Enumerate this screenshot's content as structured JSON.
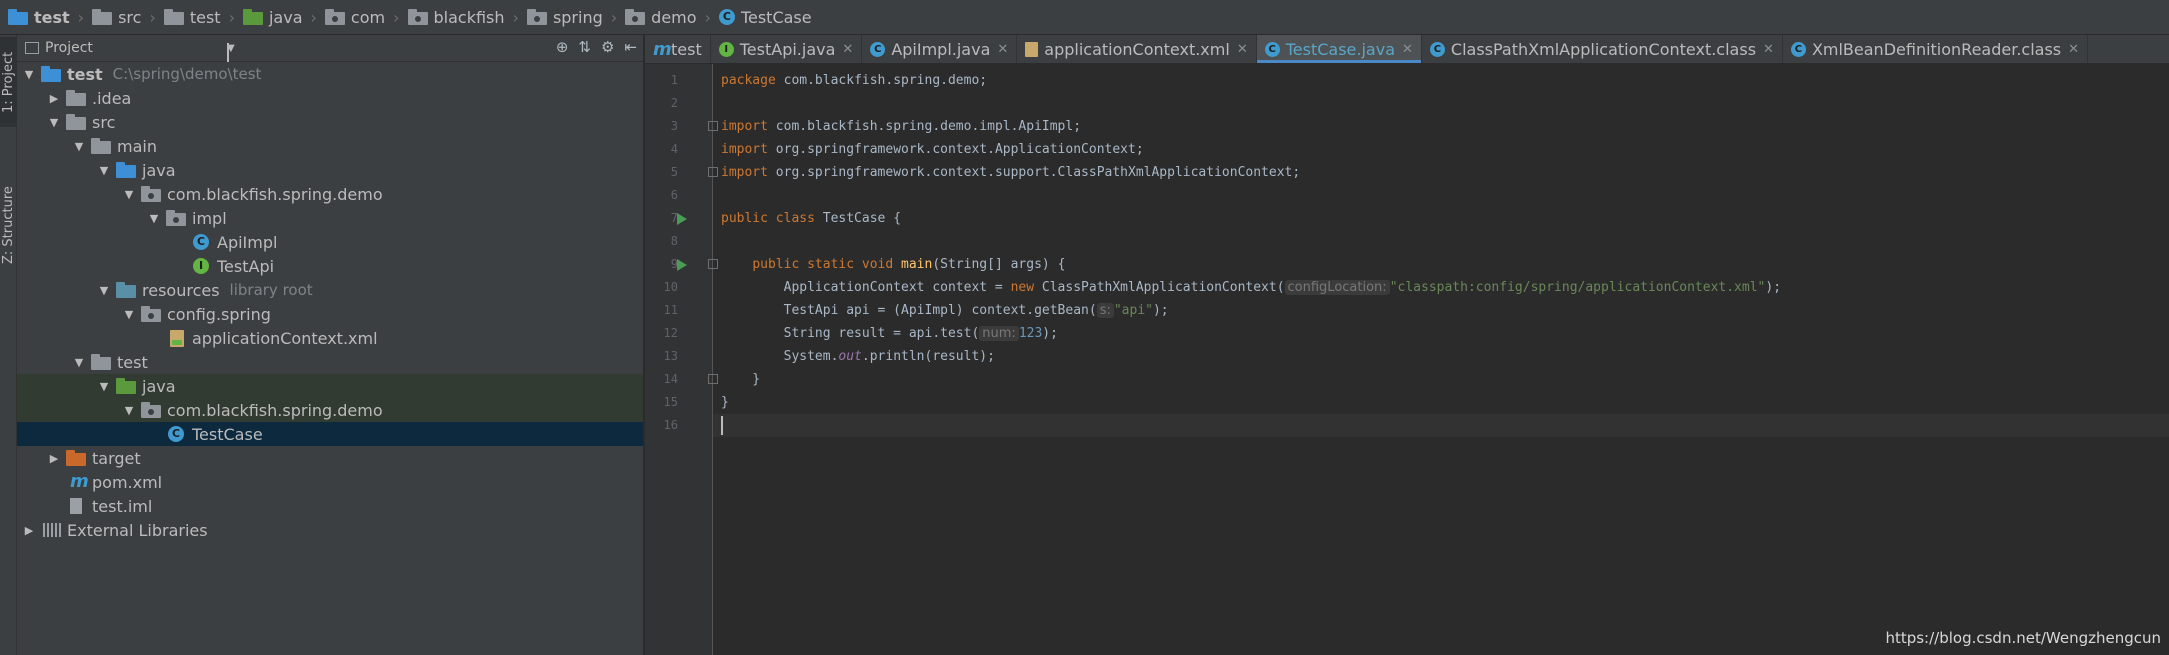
{
  "breadcrumb": [
    {
      "label": "test",
      "icon": "project-folder-icon",
      "bold": true
    },
    {
      "label": "src",
      "icon": "folder-icon"
    },
    {
      "label": "test",
      "icon": "folder-icon"
    },
    {
      "label": "java",
      "icon": "source-folder-icon"
    },
    {
      "label": "com",
      "icon": "package-icon"
    },
    {
      "label": "blackfish",
      "icon": "package-icon"
    },
    {
      "label": "spring",
      "icon": "package-icon"
    },
    {
      "label": "demo",
      "icon": "package-icon"
    },
    {
      "label": "TestCase",
      "icon": "class-icon"
    }
  ],
  "tool_stripe": {
    "project": "1: Project",
    "structure": "Z: Structure"
  },
  "project_panel": {
    "title": "Project",
    "tree": [
      {
        "label": "test",
        "extra": "C:\\spring\\demo\\test",
        "arrow": "open",
        "icon": "module-folder",
        "bold": true
      },
      {
        "label": ".idea",
        "arrow": "closed",
        "icon": "folder"
      },
      {
        "label": "src",
        "arrow": "open",
        "icon": "folder"
      },
      {
        "label": "main",
        "arrow": "open",
        "icon": "folder"
      },
      {
        "label": "java",
        "arrow": "open",
        "icon": "source-folder"
      },
      {
        "label": "com.blackfish.spring.demo",
        "arrow": "open",
        "icon": "package"
      },
      {
        "label": "impl",
        "arrow": "open",
        "icon": "package"
      },
      {
        "label": "ApiImpl",
        "arrow": "",
        "icon": "class"
      },
      {
        "label": "TestApi",
        "arrow": "",
        "icon": "interface"
      },
      {
        "label": "resources",
        "extra": "library root",
        "arrow": "open",
        "icon": "resources-folder"
      },
      {
        "label": "config.spring",
        "arrow": "open",
        "icon": "package"
      },
      {
        "label": "applicationContext.xml",
        "arrow": "",
        "icon": "xml"
      },
      {
        "label": "test",
        "arrow": "open",
        "icon": "folder"
      },
      {
        "label": "java",
        "arrow": "open",
        "icon": "test-source-folder"
      },
      {
        "label": "com.blackfish.spring.demo",
        "arrow": "open",
        "icon": "package"
      },
      {
        "label": "TestCase",
        "arrow": "",
        "icon": "class"
      },
      {
        "label": "target",
        "arrow": "closed",
        "icon": "excluded-folder"
      },
      {
        "label": "pom.xml",
        "arrow": "",
        "icon": "maven"
      },
      {
        "label": "test.iml",
        "arrow": "",
        "icon": "file"
      },
      {
        "label": "External Libraries",
        "arrow": "closed",
        "icon": "libraries"
      }
    ]
  },
  "tabs": [
    {
      "label": "test",
      "icon": "maven"
    },
    {
      "label": "TestApi.java",
      "icon": "interface"
    },
    {
      "label": "ApiImpl.java",
      "icon": "class"
    },
    {
      "label": "applicationContext.xml",
      "icon": "xml"
    },
    {
      "label": "TestCase.java",
      "icon": "class",
      "active": true
    },
    {
      "label": "ClassPathXmlApplicationContext.class",
      "icon": "class"
    },
    {
      "label": "XmlBeanDefinitionReader.class",
      "icon": "class"
    }
  ],
  "code": {
    "line_numbers": [
      "1",
      "2",
      "3",
      "4",
      "5",
      "6",
      "7",
      "8",
      "9",
      "10",
      "11",
      "12",
      "13",
      "14",
      "15",
      "16"
    ],
    "l1_kw": "package",
    "l1_rest": " com.blackfish.spring.demo;",
    "l3_kw": "import",
    "l3_rest": " com.blackfish.spring.demo.impl.ApiImpl;",
    "l4_kw": "import",
    "l4_rest": " org.springframework.context.ApplicationContext;",
    "l5_kw": "import",
    "l5_rest": " org.springframework.context.support.ClassPathXmlApplicationContext;",
    "l7_kw": "public class",
    "l7_rest": " TestCase {",
    "l9_pre": "    ",
    "l9_kw": "public static void",
    "l9_fn": "main",
    "l9_rest": "(String[] args) {",
    "l10_a": "        ApplicationContext context = ",
    "l10_kw": "new",
    "l10_b": " ClassPathXmlApplicationContext(",
    "l10_hint": "configLocation:",
    "l10_str": "\"classpath:config/spring/applicationContext.xml\"",
    "l10_end": ");",
    "l11_a": "        TestApi api = (ApiImpl) context.getBean(",
    "l11_hint": "s:",
    "l11_str": "\"api\"",
    "l11_end": ");",
    "l12_a": "        String result = api.test(",
    "l12_hint": "num:",
    "l12_num": "123",
    "l12_end": ");",
    "l13_a": "        System.",
    "l13_it": "out",
    "l13_end": ".println(result);",
    "l14": "    }",
    "l15": "}"
  },
  "watermark": "https://blog.csdn.net/Wengzhengcun"
}
